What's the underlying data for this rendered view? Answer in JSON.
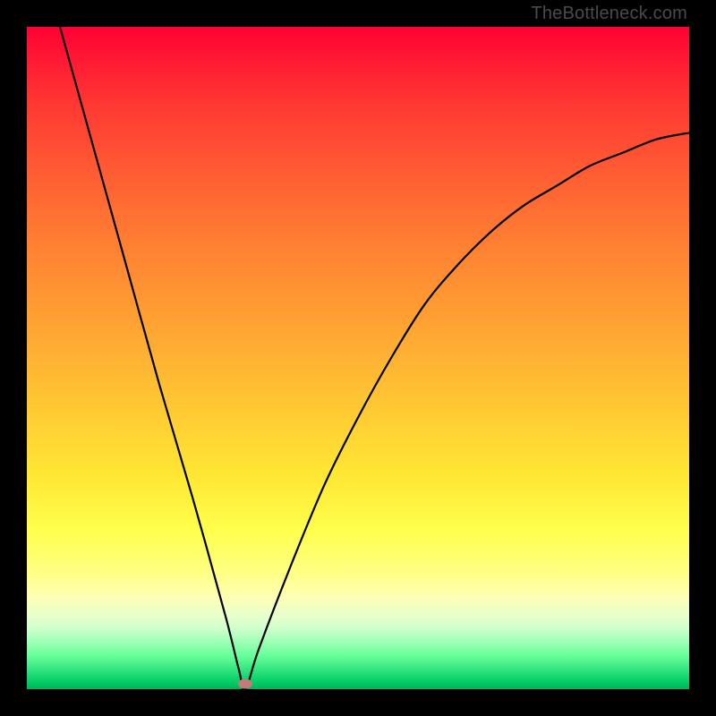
{
  "watermark": "TheBottleneck.com",
  "chart_data": {
    "type": "line",
    "title": "",
    "xlabel": "",
    "ylabel": "",
    "xlim": [
      0,
      100
    ],
    "ylim": [
      0,
      100
    ],
    "grid": false,
    "legend": false,
    "series": [
      {
        "name": "bottleneck-curve",
        "x": [
          5,
          10,
          15,
          20,
          25,
          30,
          32,
          33,
          35,
          40,
          45,
          50,
          55,
          60,
          65,
          70,
          75,
          80,
          85,
          90,
          95,
          100
        ],
        "y": [
          100,
          82,
          64,
          46,
          29,
          11,
          3,
          0,
          6,
          19,
          31,
          41,
          50,
          58,
          64,
          69,
          73,
          76,
          79,
          81,
          83,
          84
        ]
      }
    ],
    "annotations": [
      {
        "name": "minimum-marker",
        "x": 33,
        "y": 0.8,
        "shape": "ellipse",
        "color": "#c57a7a"
      }
    ],
    "background": {
      "type": "vertical-gradient",
      "stops": [
        {
          "pos": 0,
          "color": "#ff0033"
        },
        {
          "pos": 50,
          "color": "#ff9933"
        },
        {
          "pos": 75,
          "color": "#ffff4d"
        },
        {
          "pos": 92,
          "color": "#b3ffb3"
        },
        {
          "pos": 100,
          "color": "#00b359"
        }
      ]
    }
  }
}
